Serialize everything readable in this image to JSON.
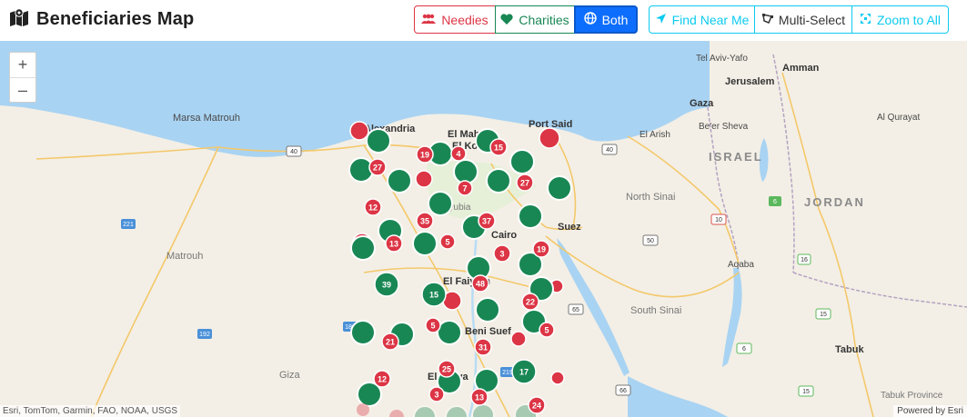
{
  "header": {
    "title": "Beneficiaries Map",
    "buttons": {
      "needies": "Needies",
      "charities": "Charities",
      "both": "Both",
      "find_near_me": "Find Near Me",
      "multi_select": "Multi-Select",
      "zoom_to_all": "Zoom to All"
    },
    "active_filter": "Both"
  },
  "colors": {
    "needy": "#dc3545",
    "charity": "#198754",
    "active": "#0d6efd",
    "accent": "#0dcaf0",
    "sea": "#a9d3f2",
    "land": "#f3efe6"
  },
  "zoom": {
    "in": "+",
    "out": "–"
  },
  "places": [
    {
      "name": "Marsa Matrouh"
    },
    {
      "name": "Alexandria"
    },
    {
      "name": "El Mahalla"
    },
    {
      "name": "El Kobra"
    },
    {
      "name": "Port Said"
    },
    {
      "name": "El Arish"
    },
    {
      "name": "Tel Aviv-Yafo"
    },
    {
      "name": "Amman"
    },
    {
      "name": "Jerusalem"
    },
    {
      "name": "Gaza"
    },
    {
      "name": "Be'er Sheva"
    },
    {
      "name": "Al Qurayat"
    },
    {
      "name": "ISRAEL"
    },
    {
      "name": "JORDAN"
    },
    {
      "name": "North Sinai"
    },
    {
      "name": "Suez"
    },
    {
      "name": "Qalyubia"
    },
    {
      "name": "Cairo"
    },
    {
      "name": "Matrouh"
    },
    {
      "name": "El Faiyum"
    },
    {
      "name": "Beni Suef"
    },
    {
      "name": "South Sinai"
    },
    {
      "name": "Aqaba"
    },
    {
      "name": "Tabuk"
    },
    {
      "name": "Tabuk Province"
    },
    {
      "name": "Giza"
    },
    {
      "name": "El Minya"
    }
  ],
  "road_shields": [
    "40",
    "40",
    "221",
    "50",
    "10",
    "192",
    "189",
    "65",
    "66",
    "15",
    "15",
    "6",
    "6",
    "219",
    "16"
  ],
  "clusters": [
    {
      "label": "19",
      "type": "needy"
    },
    {
      "label": "4",
      "type": "needy"
    },
    {
      "label": "15",
      "type": "needy"
    },
    {
      "label": "27",
      "type": "needy"
    },
    {
      "label": "27",
      "type": "needy"
    },
    {
      "label": "7",
      "type": "needy"
    },
    {
      "label": "12",
      "type": "needy"
    },
    {
      "label": "35",
      "type": "needy"
    },
    {
      "label": "37",
      "type": "needy"
    },
    {
      "label": "5",
      "type": "needy"
    },
    {
      "label": "13",
      "type": "needy"
    },
    {
      "label": "3",
      "type": "needy"
    },
    {
      "label": "19",
      "type": "needy"
    },
    {
      "label": "48",
      "type": "needy"
    },
    {
      "label": "22",
      "type": "needy"
    },
    {
      "label": "5",
      "type": "needy"
    },
    {
      "label": "5",
      "type": "needy"
    },
    {
      "label": "21",
      "type": "needy"
    },
    {
      "label": "31",
      "type": "needy"
    },
    {
      "label": "25",
      "type": "needy"
    },
    {
      "label": "3",
      "type": "needy"
    },
    {
      "label": "13",
      "type": "needy"
    },
    {
      "label": "24",
      "type": "needy"
    },
    {
      "label": "12",
      "type": "needy"
    },
    {
      "label": "39",
      "type": "charity"
    },
    {
      "label": "15",
      "type": "charity"
    },
    {
      "label": "17",
      "type": "charity"
    }
  ],
  "attribution": "Esri, TomTom, Garmin, FAO, NOAA, USGS",
  "powered_by": "Powered by Esri"
}
